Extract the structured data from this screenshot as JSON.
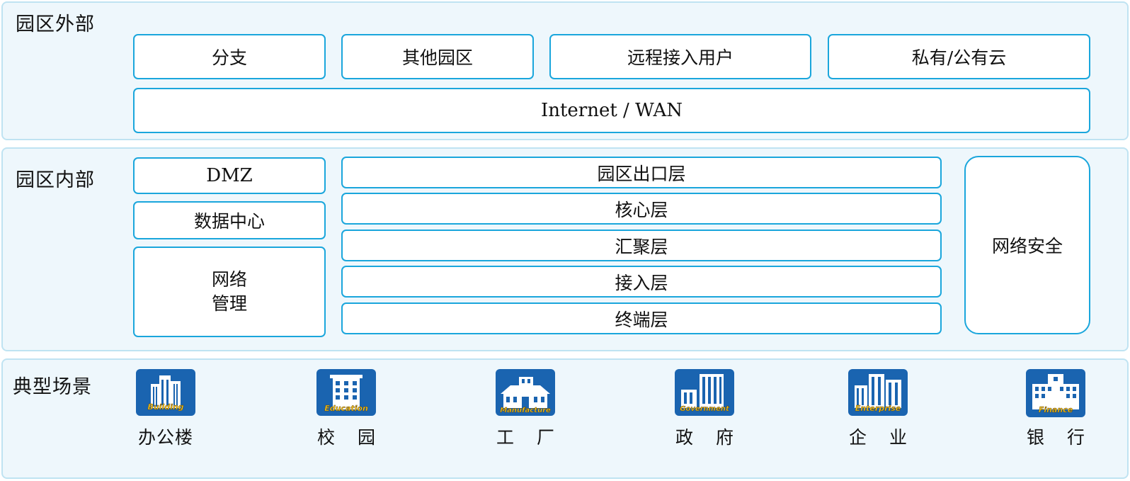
{
  "outside": {
    "title": "园区外部",
    "branches": [
      "分支",
      "其他园区",
      "远程接入用户",
      "私有/公有云"
    ],
    "wan": "Internet / WAN"
  },
  "inside": {
    "title": "园区内部",
    "dmz": "DMZ",
    "datacenter": "数据中心",
    "netmgmt_line1": "网络",
    "netmgmt_line2": "管理",
    "layers": [
      "园区出口层",
      "核心层",
      "汇聚层",
      "接入层",
      "终端层"
    ],
    "security": "网络安全"
  },
  "scenarios": {
    "title": "典型场景",
    "items": [
      {
        "label": "办公楼",
        "icon": "office-building-icon",
        "icon_text": "Building"
      },
      {
        "label": "校 园",
        "icon": "school-icon",
        "icon_text": "Education"
      },
      {
        "label": "工 厂",
        "icon": "factory-icon",
        "icon_text": "Manufacture"
      },
      {
        "label": "政 府",
        "icon": "government-icon",
        "icon_text": "Government"
      },
      {
        "label": "企 业",
        "icon": "enterprise-icon",
        "icon_text": "Enterprise"
      },
      {
        "label": "银 行",
        "icon": "bank-icon",
        "icon_text": "Finance"
      }
    ]
  },
  "colors": {
    "accent_border": "#1aa6dc",
    "zone_fill": "#eef7fc",
    "zone_border": "#bfe3f2",
    "icon_blue": "#1a64b0",
    "icon_label_yellow": "#f3c21b"
  }
}
